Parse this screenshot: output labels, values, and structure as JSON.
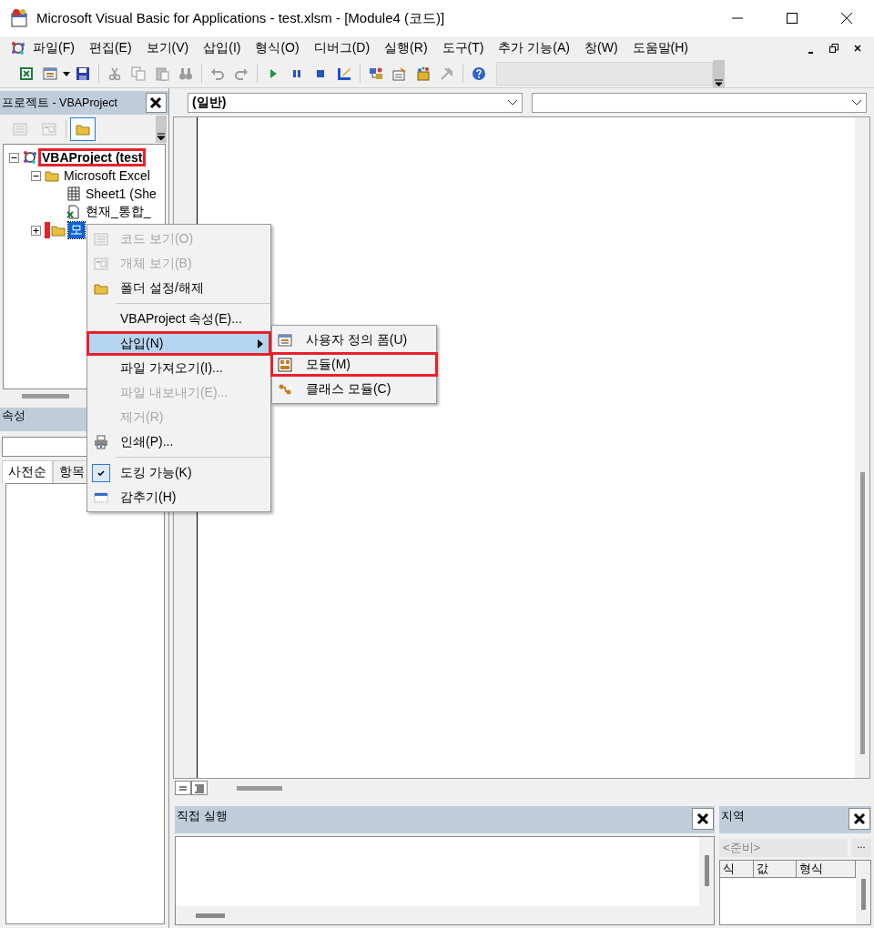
{
  "window": {
    "title": "Microsoft Visual Basic for Applications - test.xlsm - [Module4 (코드)]"
  },
  "menu_bar": [
    "파일(F)",
    "편집(E)",
    "보기(V)",
    "삽입(I)",
    "형식(O)",
    "디버그(D)",
    "실행(R)",
    "도구(T)",
    "추가 기능(A)",
    "창(W)",
    "도움말(H)"
  ],
  "toolbar": [
    {
      "kind": "button",
      "disabled": false
    },
    {
      "kind": "button",
      "disabled": false
    },
    {
      "kind": "button",
      "disabled": false
    },
    {
      "kind": "separator"
    },
    {
      "kind": "button",
      "disabled": true
    },
    {
      "kind": "button",
      "disabled": true
    },
    {
      "kind": "button",
      "disabled": true
    },
    {
      "kind": "button",
      "disabled": true
    },
    {
      "kind": "separator"
    },
    {
      "kind": "button",
      "disabled": true
    },
    {
      "kind": "button",
      "disabled": true
    },
    {
      "kind": "separator"
    },
    {
      "kind": "button",
      "disabled": false
    },
    {
      "kind": "button",
      "disabled": false
    },
    {
      "kind": "button",
      "disabled": false
    },
    {
      "kind": "button",
      "disabled": false
    },
    {
      "kind": "separator"
    },
    {
      "kind": "button",
      "disabled": false
    },
    {
      "kind": "button",
      "disabled": false
    },
    {
      "kind": "button",
      "disabled": false
    },
    {
      "kind": "button",
      "disabled": true
    },
    {
      "kind": "separator"
    },
    {
      "kind": "button",
      "disabled": false
    },
    {
      "kind": "field"
    }
  ],
  "project_explorer": {
    "title": "프로젝트 - VBAProject",
    "toolbar": [
      {
        "disabled": true,
        "on": false
      },
      {
        "disabled": true,
        "on": false
      },
      {
        "disabled": false,
        "on": true
      }
    ],
    "tree": [
      {
        "label": "VBAProject (test",
        "kind": "project",
        "expanded": true,
        "selected": false,
        "marked": true,
        "children": [
          {
            "label": "Microsoft Excel",
            "kind": "folder",
            "expanded": true,
            "selected": false,
            "marked": false,
            "children": [
              {
                "label": "Sheet1 (She",
                "kind": "sheet",
                "selected": false,
                "marked": false
              },
              {
                "label": "현재_통합_",
                "kind": "workbook",
                "selected": false,
                "marked": false
              }
            ]
          },
          {
            "label": "모",
            "kind": "folder",
            "expanded": false,
            "selected": true,
            "marked": true
          }
        ]
      }
    ]
  },
  "properties": {
    "title": "속성",
    "tabs": [
      {
        "label": "사전순",
        "selected": true
      },
      {
        "label": "항목",
        "selected": false
      }
    ]
  },
  "code_window": {
    "object_dropdown": "(일반)"
  },
  "immediate": {
    "title": "직접 실행"
  },
  "locals": {
    "title": "지역",
    "context": "<준비>",
    "context_button": "...",
    "columns": [
      "식",
      "값",
      "형식"
    ]
  },
  "context_menu": {
    "items": [
      {
        "kind": "item",
        "label": "코드 보기(O)",
        "disabled": true,
        "checked": false,
        "selected": false,
        "marked": false
      },
      {
        "kind": "item",
        "label": "개체 보기(B)",
        "disabled": true,
        "checked": false,
        "selected": false,
        "marked": false
      },
      {
        "kind": "item",
        "label": "폴더 설정/해제",
        "disabled": false,
        "checked": false,
        "selected": false,
        "marked": false
      },
      {
        "kind": "separator"
      },
      {
        "kind": "item",
        "label": "VBAProject 속성(E)...",
        "disabled": false,
        "checked": false,
        "selected": false,
        "marked": false
      },
      {
        "kind": "item",
        "label": "삽입(N)",
        "disabled": false,
        "checked": false,
        "selected": true,
        "marked": true,
        "submenu": [
          {
            "label": "사용자 정의 폼(U)",
            "marked": false
          },
          {
            "label": "모듈(M)",
            "marked": true
          },
          {
            "label": "클래스 모듈(C)",
            "marked": false
          }
        ]
      },
      {
        "kind": "item",
        "label": "파일 가져오기(I)...",
        "disabled": false,
        "checked": false,
        "selected": false,
        "marked": false
      },
      {
        "kind": "item",
        "label": "파일 내보내기(E)...",
        "disabled": true,
        "checked": false,
        "selected": false,
        "marked": false
      },
      {
        "kind": "item",
        "label": "제거(R)",
        "disabled": true,
        "checked": false,
        "selected": false,
        "marked": false
      },
      {
        "kind": "item",
        "label": "인쇄(P)...",
        "disabled": false,
        "checked": false,
        "selected": false,
        "marked": false
      },
      {
        "kind": "separator"
      },
      {
        "kind": "item",
        "label": "도킹 가능(K)",
        "disabled": false,
        "checked": true,
        "selected": false,
        "marked": false
      },
      {
        "kind": "item",
        "label": "감추기(H)",
        "disabled": false,
        "checked": false,
        "selected": false,
        "marked": false
      }
    ]
  }
}
